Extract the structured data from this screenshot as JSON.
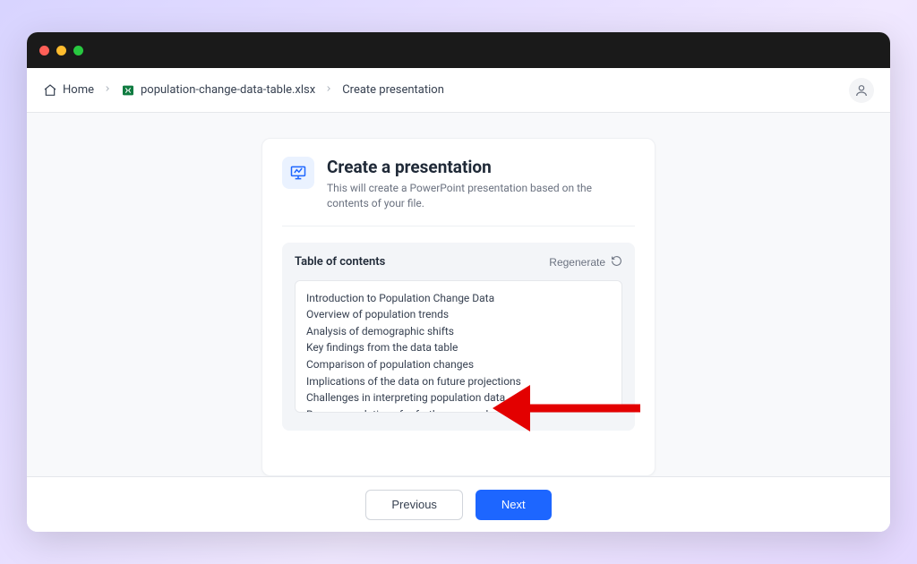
{
  "breadcrumb": {
    "home_label": "Home",
    "file_label": "population-change-data-table.xlsx",
    "current_label": "Create presentation"
  },
  "card": {
    "title": "Create a presentation",
    "subtitle": "This will create a PowerPoint presentation based on the contents of your file."
  },
  "toc": {
    "heading": "Table of contents",
    "regenerate_label": "Regenerate",
    "items": [
      "Introduction to Population Change Data",
      "Overview of population trends",
      "Analysis of demographic shifts",
      "Key findings from the data table",
      "Comparison of population changes",
      "Implications of the data on future projections",
      "Challenges in interpreting population data",
      "Recommendations for further research"
    ]
  },
  "footer": {
    "previous_label": "Previous",
    "next_label": "Next"
  }
}
